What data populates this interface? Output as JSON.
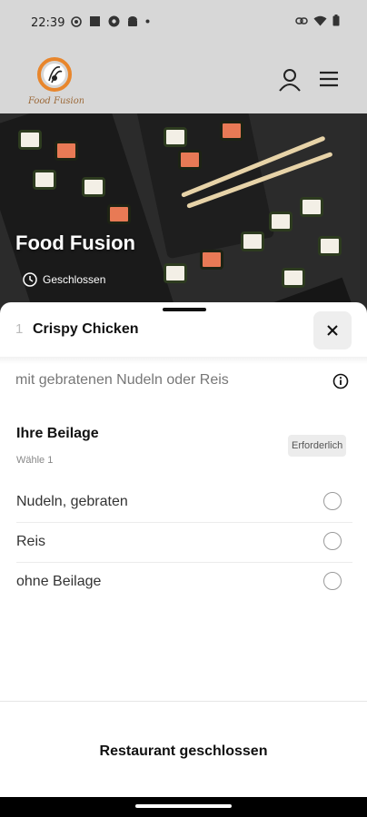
{
  "status_bar": {
    "time": "22:39",
    "left_icons": [
      "app-icon",
      "square-icon",
      "settings-icon",
      "android-icon",
      "dot-icon"
    ],
    "right_icons": [
      "link-icon",
      "wifi-icon",
      "battery-icon"
    ]
  },
  "app_bar": {
    "logo_text": "Food Fusion",
    "icons": [
      "user-icon",
      "menu-icon"
    ]
  },
  "hero": {
    "restaurant_name": "Food Fusion",
    "status": "Geschlossen"
  },
  "sheet": {
    "quantity": "1",
    "item_title": "Crispy Chicken",
    "description": "mit gebratenen Nudeln oder Reis",
    "group": {
      "title": "Ihre Beilage",
      "subtitle": "Wähle 1",
      "badge": "Erforderlich",
      "options": [
        {
          "label": "Nudeln, gebraten",
          "selected": false
        },
        {
          "label": "Reis",
          "selected": false
        },
        {
          "label": "ohne Beilage",
          "selected": false
        }
      ]
    },
    "footer_button": "Restaurant geschlossen"
  },
  "colors": {
    "appbar_bg": "#d7d7d7",
    "logo_orange": "#e8862c"
  }
}
